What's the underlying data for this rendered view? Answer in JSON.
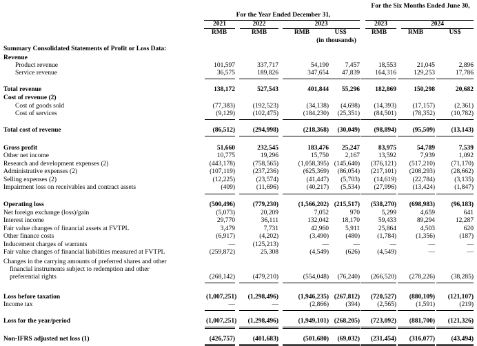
{
  "header": {
    "year_group": "For the Year Ended December 31,",
    "six_month_group": "For the Six Months Ended June 30,",
    "years": [
      "2021",
      "2022",
      "2023",
      "2023",
      "2024"
    ],
    "currencies": [
      "RMB",
      "RMB",
      "RMB",
      "US$",
      "RMB",
      "RMB",
      "US$"
    ],
    "in_thousands": "(in thousands)"
  },
  "section_title": "Summary Consolidated Statements of Profit or Loss Data:",
  "rows": [
    {
      "label": "Revenue",
      "bold": true,
      "values": []
    },
    {
      "label": "Product revenue",
      "indent": true,
      "values": [
        "101,597",
        "337,717",
        "54,190",
        "7,457",
        "18,553",
        "21,045",
        "2,896"
      ]
    },
    {
      "label": "Service revenue",
      "indent": true,
      "values": [
        "36,575",
        "189,826",
        "347,654",
        "47,839",
        "164,316",
        "129,253",
        "17,786"
      ]
    },
    {
      "label": "Total revenue",
      "bold": true,
      "values": [
        "138,172",
        "527,543",
        "401,844",
        "55,296",
        "182,869",
        "150,298",
        "20,682"
      ]
    },
    {
      "label": "Cost of revenue (2)",
      "bold": true,
      "values": []
    },
    {
      "label": "Cost of goods sold",
      "indent": true,
      "values": [
        "(77,383)",
        "(192,523)",
        "(34,138)",
        "(4,698)",
        "(14,393)",
        "(17,157)",
        "(2,361)"
      ]
    },
    {
      "label": "Cost of services",
      "indent": true,
      "values": [
        "(9,129)",
        "(102,475)",
        "(184,230)",
        "(25,351)",
        "(84,501)",
        "(78,352)",
        "(10,782)"
      ]
    },
    {
      "label": "Total cost of revenue",
      "bold": true,
      "values": [
        "(86,512)",
        "(294,998)",
        "(218,368)",
        "(30,049)",
        "(98,894)",
        "(95,509)",
        "(13,143)"
      ]
    },
    {
      "label": "Gross profit",
      "bold": true,
      "values": [
        "51,660",
        "232,545",
        "183,476",
        "25,247",
        "83,975",
        "54,789",
        "7,539"
      ]
    },
    {
      "label": "Other net income",
      "values": [
        "10,775",
        "19,296",
        "15,750",
        "2,167",
        "13,592",
        "7,939",
        "1,092"
      ]
    },
    {
      "label": "Research and development expenses (2)",
      "values": [
        "(443,178)",
        "(758,565)",
        "(1,058,395)",
        "(145,640)",
        "(376,121)",
        "(517,210)",
        "(71,170)"
      ]
    },
    {
      "label": "Administrative expenses (2)",
      "values": [
        "(107,119)",
        "(237,236)",
        "(625,369)",
        "(86,054)",
        "(217,101)",
        "(208,293)",
        "(28,662)"
      ]
    },
    {
      "label": "Selling expenses (2)",
      "values": [
        "(12,225)",
        "(23,574)",
        "(41,447)",
        "(5,703)",
        "(14,619)",
        "(22,784)",
        "(3,135)"
      ]
    },
    {
      "label": "Impairment loss on receivables and contract assets",
      "values": [
        "(409)",
        "(11,696)",
        "(40,217)",
        "(5,534)",
        "(27,996)",
        "(13,424)",
        "(1,847)"
      ]
    },
    {
      "label": "Operating loss",
      "bold": true,
      "values": [
        "(500,496)",
        "(779,230)",
        "(1,566,202)",
        "(215,517)",
        "(538,270)",
        "(698,983)",
        "(96,183)"
      ]
    },
    {
      "label": "Net foreign exchange (loss)/gain",
      "values": [
        "(5,073)",
        "20,209",
        "7,052",
        "970",
        "5,299",
        "4,659",
        "641"
      ]
    },
    {
      "label": "Interest income",
      "values": [
        "29,770",
        "36,111",
        "132,042",
        "18,170",
        "59,433",
        "89,294",
        "12,287"
      ]
    },
    {
      "label": "Fair value changes of financial assets at FVTPL",
      "values": [
        "3,479",
        "7,731",
        "42,960",
        "5,911",
        "25,864",
        "4,503",
        "620"
      ]
    },
    {
      "label": "Other finance costs",
      "values": [
        "(6,917)",
        "(4,202)",
        "(3,490)",
        "(480)",
        "(1,784)",
        "(1,356)",
        "(187)"
      ]
    },
    {
      "label": "Inducement charges of warrants",
      "values": [
        "—",
        "(125,213)",
        "—",
        "—",
        "—",
        "—",
        "—"
      ]
    },
    {
      "label": "Fair value changes of financial liabilities measured at FVTPL",
      "values": [
        "(259,872)",
        "25,308",
        "(4,549)",
        "(626)",
        "(4,549)",
        "—",
        "—"
      ]
    },
    {
      "label": "Changes in the carrying amounts of preferred shares and other financial instruments subject to redemption and other preferential rights",
      "multiline": [
        "Changes in the carrying amounts of preferred shares and other",
        "financial instruments subject to redemption and other",
        "preferential rights"
      ],
      "values": [
        "(268,142)",
        "(479,210)",
        "(554,048)",
        "(76,240)",
        "(266,520)",
        "(278,226)",
        "(38,285)"
      ]
    },
    {
      "label": "Loss before taxation",
      "bold": true,
      "values": [
        "(1,007,251)",
        "(1,298,496)",
        "(1,946,235)",
        "(267,812)",
        "(720,527)",
        "(880,109)",
        "(121,107)"
      ]
    },
    {
      "label": "Income tax",
      "values": [
        "—",
        "—",
        "(2,866)",
        "(394)",
        "(2,565)",
        "(1,591)",
        "(219)"
      ]
    },
    {
      "label": "Loss for the year/period",
      "bold": true,
      "values": [
        "(1,007,251)",
        "(1,298,496)",
        "(1,949,101)",
        "(268,205)",
        "(723,092)",
        "(881,700)",
        "(121,326)"
      ]
    },
    {
      "label": "Non-IFRS adjusted net loss (1)",
      "bold": true,
      "values": [
        "(426,757)",
        "(401,683)",
        "(501,680)",
        "(69,032)",
        "(231,454)",
        "(316,077)",
        "(43,494)"
      ]
    }
  ]
}
